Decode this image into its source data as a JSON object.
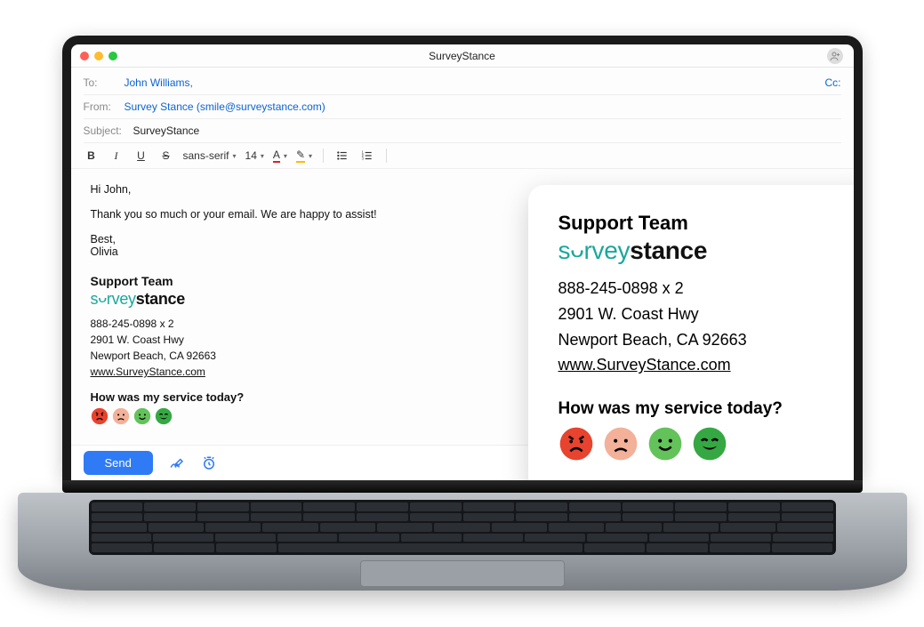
{
  "window": {
    "title": "SurveyStance"
  },
  "header": {
    "to_label": "To:",
    "to_value": "John Williams",
    "to_comma": ",",
    "cc_label": "Cc:",
    "from_label": "From:",
    "from_value": "Survey Stance (smile@surveystance.com)",
    "subject_label": "Subject:",
    "subject_value": "SurveyStance"
  },
  "toolbar": {
    "bold": "B",
    "italic": "I",
    "underline": "U",
    "strike": "S",
    "font_family": "sans-serif",
    "font_size": "14",
    "text_color_letter": "A",
    "highlight_tip": "✎"
  },
  "body": {
    "greeting": "Hi John,",
    "line1": "Thank you so much or your email. We are happy to assist!",
    "closing": "Best,",
    "signature_name": "Olivia"
  },
  "signature": {
    "team": "Support Team",
    "logo_a": "s",
    "logo_smile": "ש",
    "logo_b": "rvey",
    "logo_c": "stance",
    "phone": "888-245-0898 x 2",
    "addr1": "2901 W. Coast Hwy",
    "addr2": "Newport Beach, CA 92663",
    "website": "www.SurveyStance.com",
    "prompt": "How was my service today?",
    "faces": [
      {
        "name": "angry-face-icon",
        "color": "#e8432f",
        "mood": "angry"
      },
      {
        "name": "sad-face-icon",
        "color": "#f3b199",
        "mood": "sad"
      },
      {
        "name": "happy-face-icon",
        "color": "#63c25a",
        "mood": "happy"
      },
      {
        "name": "very-happy-face-icon",
        "color": "#35a843",
        "mood": "veryhappy"
      }
    ]
  },
  "bottombar": {
    "send": "Send",
    "format_hint": "TI"
  },
  "icons": {
    "contact": "contact-icon",
    "signature": "signature-icon",
    "schedule": "schedule-icon",
    "template": "template-icon",
    "attach": "attach-icon",
    "format": "format-icon"
  }
}
